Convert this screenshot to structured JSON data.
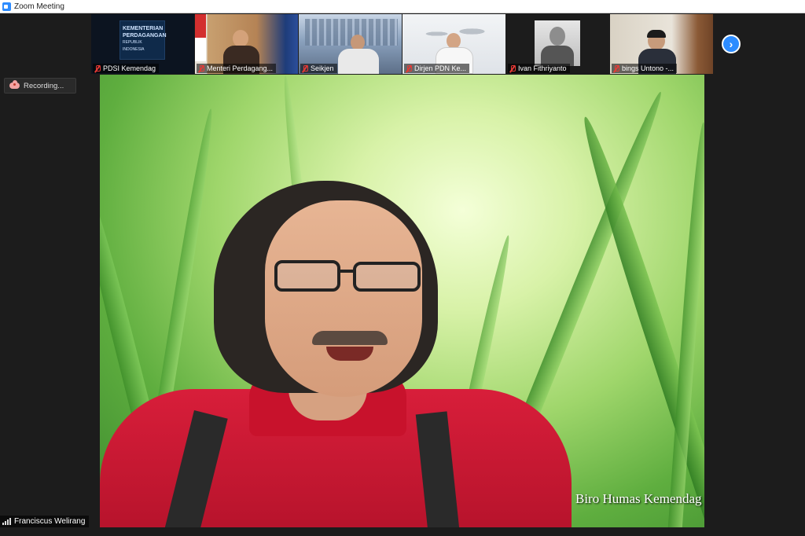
{
  "window": {
    "title": "Zoom Meeting"
  },
  "recording": {
    "label": "Recording..."
  },
  "participants": [
    {
      "name": "PDSI Kemendag",
      "muted": true,
      "logo_lines": [
        "KEMENTERIAN",
        "PERDAGANGAN",
        "REPUBLIK INDONESIA"
      ]
    },
    {
      "name": "Menteri Perdagang...",
      "muted": true
    },
    {
      "name": "Seikjen",
      "muted": true
    },
    {
      "name": "Dirjen PDN Ke...",
      "muted": true
    },
    {
      "name": "Ivan Fithriyanto",
      "muted": true
    },
    {
      "name": "bings Untono -...",
      "muted": true
    }
  ],
  "active_speaker": {
    "name": "Franciscus Welirang",
    "watermark": "Biro Humas Kemendag"
  },
  "colors": {
    "accent": "#2d8cff",
    "muted_mic": "#e53935"
  },
  "icons": {
    "next": "chevron-right-icon",
    "recording": "cloud-record-icon",
    "signal": "signal-strength-icon"
  }
}
